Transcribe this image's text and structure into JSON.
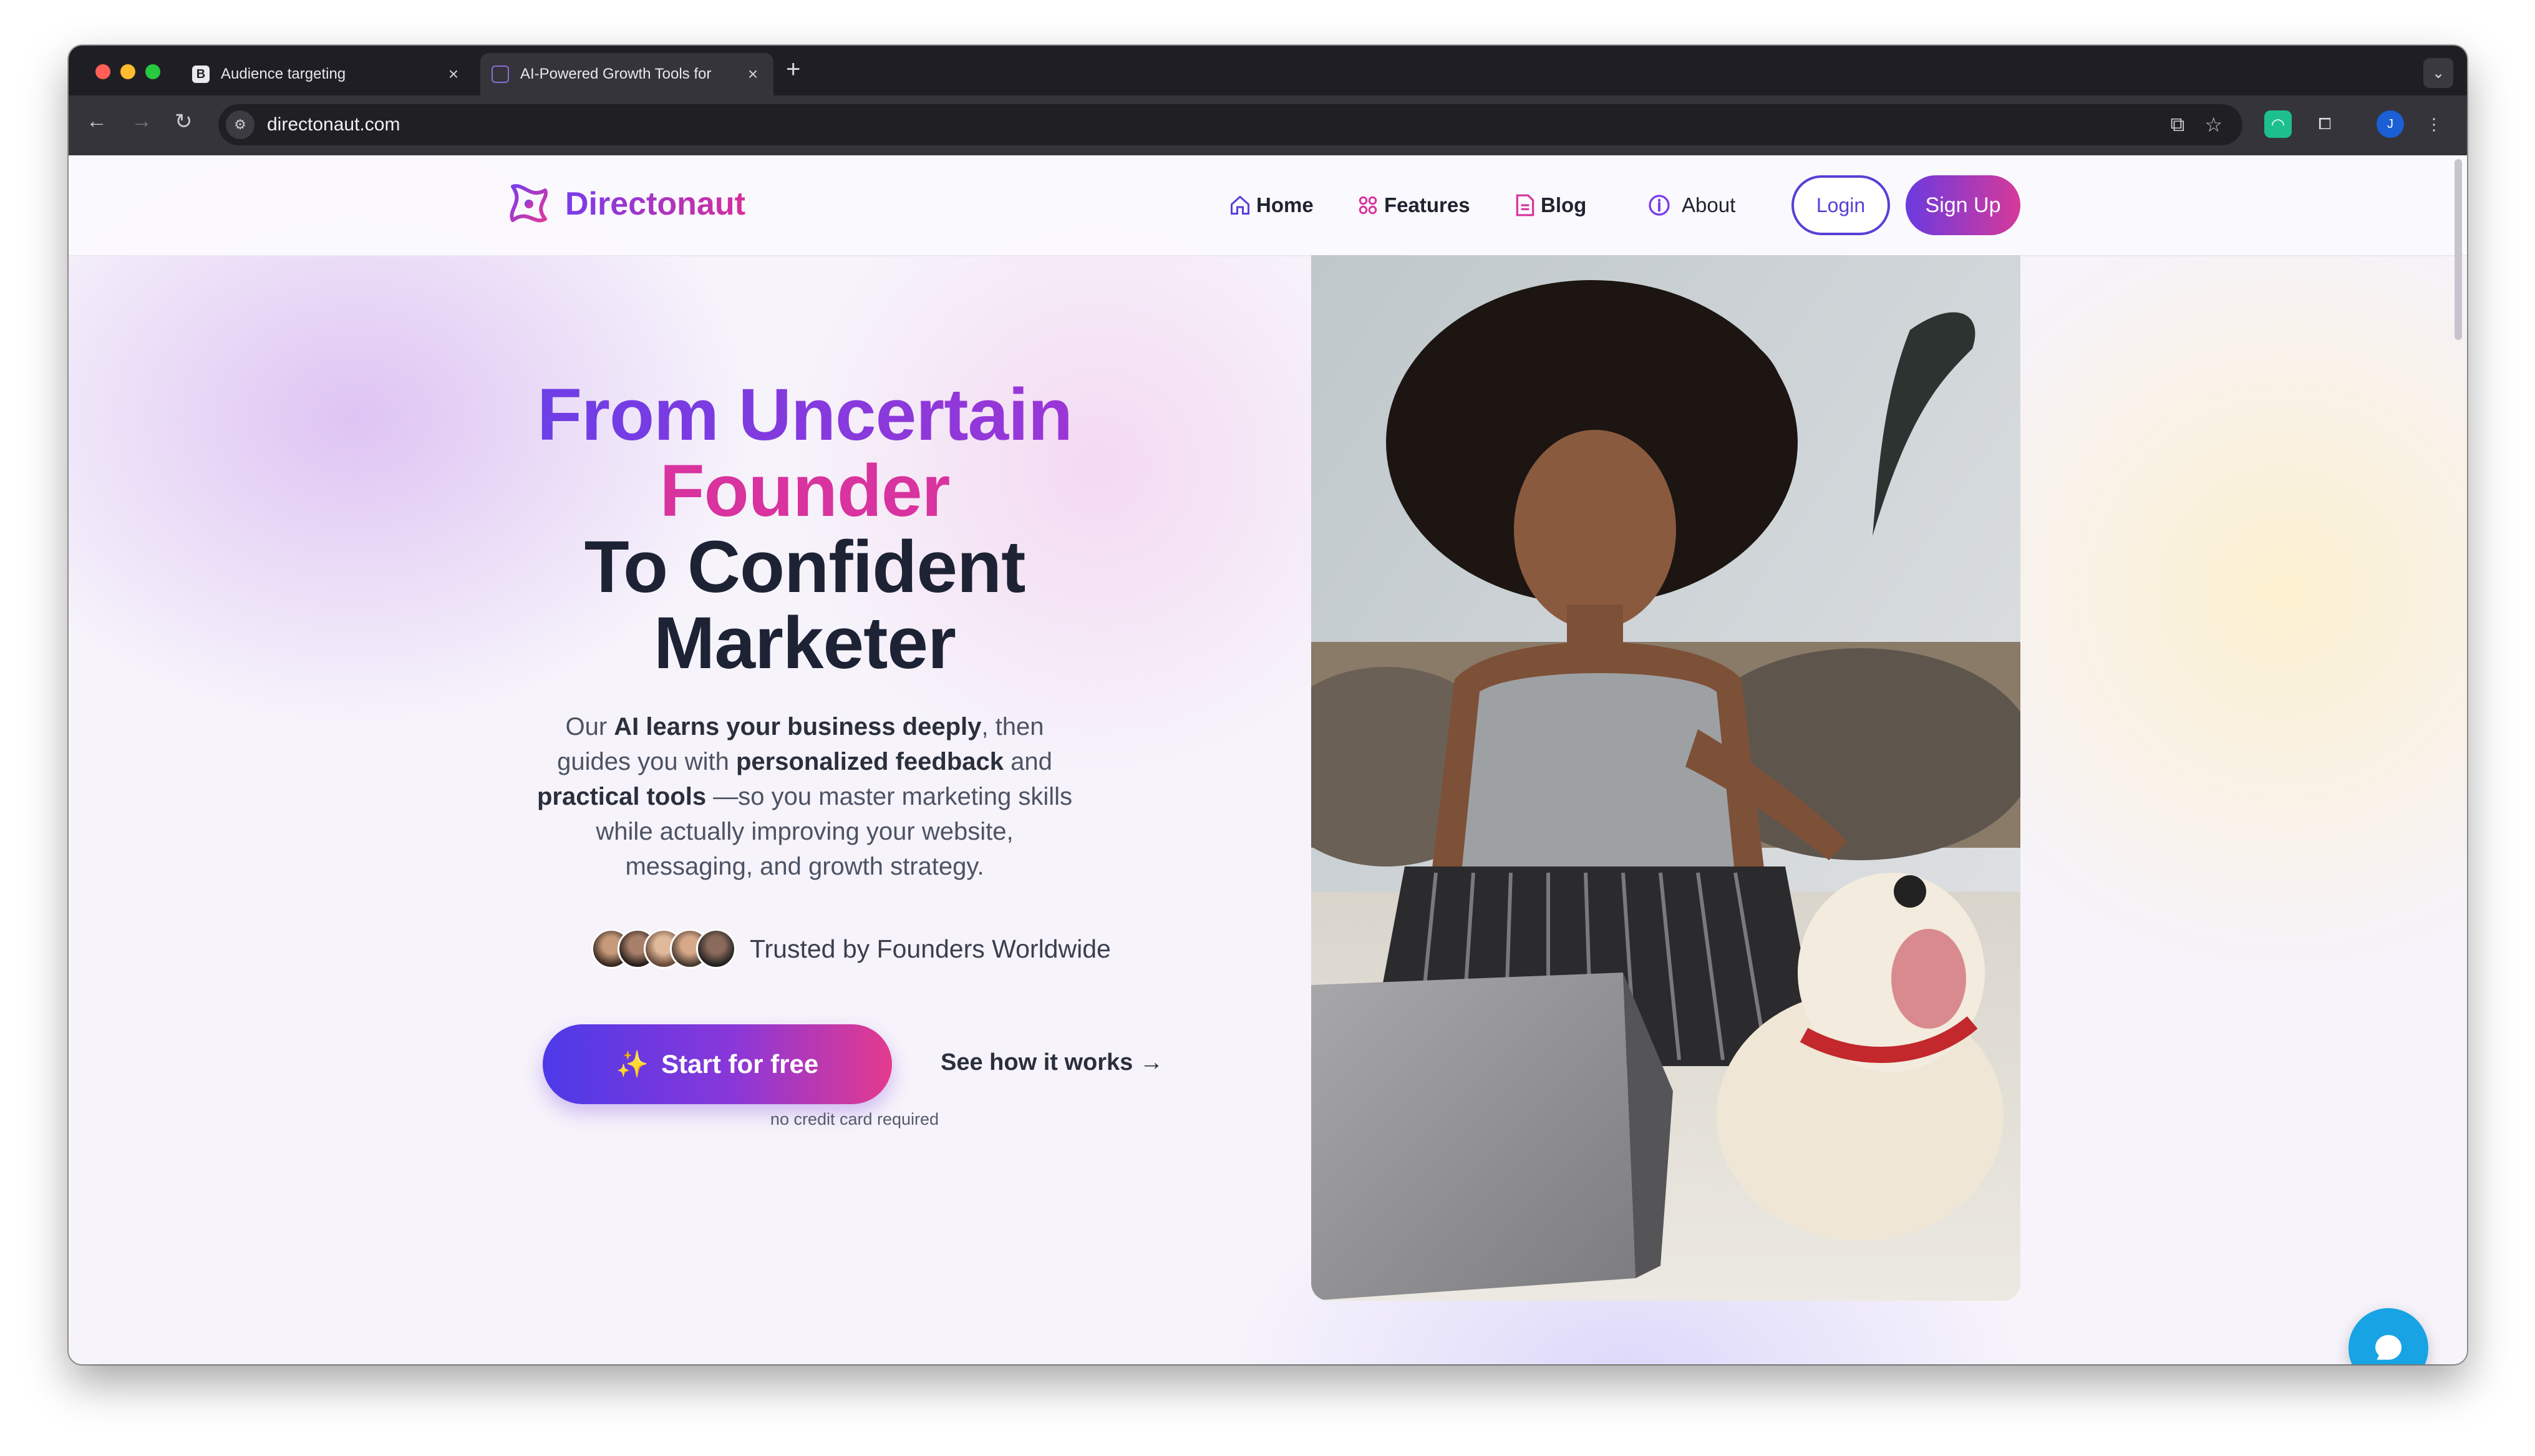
{
  "browser": {
    "tabs": [
      {
        "title": "Audience targeting",
        "favicon": "B",
        "active": false
      },
      {
        "title": "AI-Powered Growth Tools for",
        "active": true
      }
    ],
    "url": "directonaut.com",
    "profile_initial": "J"
  },
  "site": {
    "brand": "Directonaut",
    "nav": {
      "home": "Home",
      "features": "Features",
      "blog": "Blog",
      "about": "About",
      "login": "Login",
      "signup": "Sign Up"
    },
    "hero": {
      "title_line1": "From Uncertain",
      "title_line2": "Founder",
      "title_line3": "To Confident",
      "title_line4": "Marketer",
      "desc": {
        "p1": "Our ",
        "b1": "AI learns your business deeply",
        "p2": ", then guides you with ",
        "b2": "personalized feedback",
        "p3": " and ",
        "b3": "practical tools",
        "p4": " —so you master marketing skills while actually improving your website, messaging, and growth strategy."
      },
      "trusted": "Trusted by Founders Worldwide",
      "cta_primary": "Start for free",
      "cta_secondary": "See how it works",
      "cta_note": "no credit card required"
    }
  },
  "colors": {
    "brand_purple": "#6b3ae0",
    "brand_pink": "#d8339e",
    "chat_blue": "#18a3e4"
  }
}
